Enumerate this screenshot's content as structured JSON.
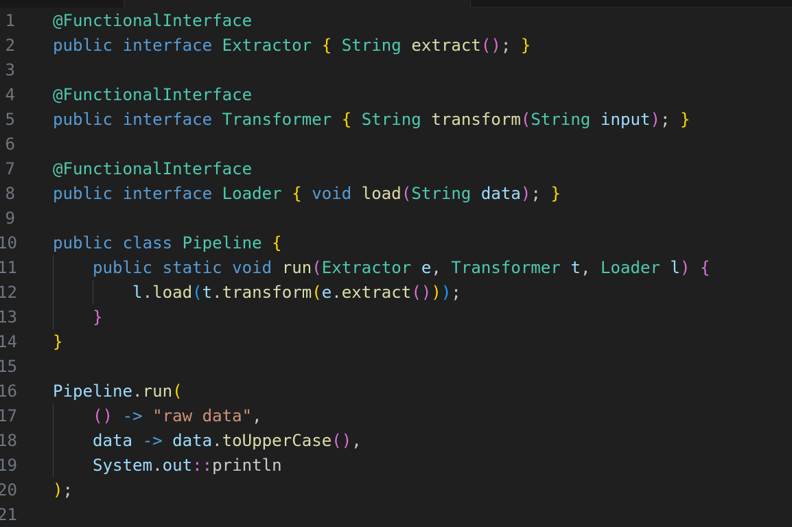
{
  "editor": {
    "language": "java",
    "lines": [
      {
        "number": "1",
        "tokens": [
          {
            "t": "@FunctionalInterface",
            "c": "ty"
          }
        ]
      },
      {
        "number": "2",
        "tokens": [
          {
            "t": "public",
            "c": "kw"
          },
          {
            "t": " ",
            "c": "pl"
          },
          {
            "t": "interface",
            "c": "kw"
          },
          {
            "t": " ",
            "c": "pl"
          },
          {
            "t": "Extractor",
            "c": "ty"
          },
          {
            "t": " ",
            "c": "pl"
          },
          {
            "t": "{",
            "c": "b1"
          },
          {
            "t": " ",
            "c": "pl"
          },
          {
            "t": "String",
            "c": "ty"
          },
          {
            "t": " ",
            "c": "pl"
          },
          {
            "t": "extract",
            "c": "fn"
          },
          {
            "t": "()",
            "c": "b2"
          },
          {
            "t": "; ",
            "c": "pl"
          },
          {
            "t": "}",
            "c": "b1"
          }
        ]
      },
      {
        "number": "3",
        "tokens": []
      },
      {
        "number": "4",
        "tokens": [
          {
            "t": "@FunctionalInterface",
            "c": "ty"
          }
        ]
      },
      {
        "number": "5",
        "tokens": [
          {
            "t": "public",
            "c": "kw"
          },
          {
            "t": " ",
            "c": "pl"
          },
          {
            "t": "interface",
            "c": "kw"
          },
          {
            "t": " ",
            "c": "pl"
          },
          {
            "t": "Transformer",
            "c": "ty"
          },
          {
            "t": " ",
            "c": "pl"
          },
          {
            "t": "{",
            "c": "b1"
          },
          {
            "t": " ",
            "c": "pl"
          },
          {
            "t": "String",
            "c": "ty"
          },
          {
            "t": " ",
            "c": "pl"
          },
          {
            "t": "transform",
            "c": "fn"
          },
          {
            "t": "(",
            "c": "b2"
          },
          {
            "t": "String",
            "c": "ty"
          },
          {
            "t": " ",
            "c": "pl"
          },
          {
            "t": "input",
            "c": "vr"
          },
          {
            "t": ")",
            "c": "b2"
          },
          {
            "t": "; ",
            "c": "pl"
          },
          {
            "t": "}",
            "c": "b1"
          }
        ]
      },
      {
        "number": "6",
        "tokens": []
      },
      {
        "number": "7",
        "tokens": [
          {
            "t": "@FunctionalInterface",
            "c": "ty"
          }
        ]
      },
      {
        "number": "8",
        "tokens": [
          {
            "t": "public",
            "c": "kw"
          },
          {
            "t": " ",
            "c": "pl"
          },
          {
            "t": "interface",
            "c": "kw"
          },
          {
            "t": " ",
            "c": "pl"
          },
          {
            "t": "Loader",
            "c": "ty"
          },
          {
            "t": " ",
            "c": "pl"
          },
          {
            "t": "{",
            "c": "b1"
          },
          {
            "t": " ",
            "c": "pl"
          },
          {
            "t": "void",
            "c": "kw"
          },
          {
            "t": " ",
            "c": "pl"
          },
          {
            "t": "load",
            "c": "fn"
          },
          {
            "t": "(",
            "c": "b2"
          },
          {
            "t": "String",
            "c": "ty"
          },
          {
            "t": " ",
            "c": "pl"
          },
          {
            "t": "data",
            "c": "vr"
          },
          {
            "t": ")",
            "c": "b2"
          },
          {
            "t": "; ",
            "c": "pl"
          },
          {
            "t": "}",
            "c": "b1"
          }
        ]
      },
      {
        "number": "9",
        "tokens": []
      },
      {
        "number": "10",
        "tokens": [
          {
            "t": "public",
            "c": "kw"
          },
          {
            "t": " ",
            "c": "pl"
          },
          {
            "t": "class",
            "c": "kw"
          },
          {
            "t": " ",
            "c": "pl"
          },
          {
            "t": "Pipeline",
            "c": "ty"
          },
          {
            "t": " ",
            "c": "pl"
          },
          {
            "t": "{",
            "c": "b1"
          }
        ]
      },
      {
        "number": "11",
        "tokens": [
          {
            "t": "    ",
            "c": "pl"
          },
          {
            "t": "public",
            "c": "kw"
          },
          {
            "t": " ",
            "c": "pl"
          },
          {
            "t": "static",
            "c": "kw"
          },
          {
            "t": " ",
            "c": "pl"
          },
          {
            "t": "void",
            "c": "kw"
          },
          {
            "t": " ",
            "c": "pl"
          },
          {
            "t": "run",
            "c": "fn"
          },
          {
            "t": "(",
            "c": "b2"
          },
          {
            "t": "Extractor",
            "c": "ty"
          },
          {
            "t": " ",
            "c": "pl"
          },
          {
            "t": "e",
            "c": "vr"
          },
          {
            "t": ", ",
            "c": "pl"
          },
          {
            "t": "Transformer",
            "c": "ty"
          },
          {
            "t": " ",
            "c": "pl"
          },
          {
            "t": "t",
            "c": "vr"
          },
          {
            "t": ", ",
            "c": "pl"
          },
          {
            "t": "Loader",
            "c": "ty"
          },
          {
            "t": " ",
            "c": "pl"
          },
          {
            "t": "l",
            "c": "vr"
          },
          {
            "t": ")",
            "c": "b2"
          },
          {
            "t": " ",
            "c": "pl"
          },
          {
            "t": "{",
            "c": "b2"
          }
        ]
      },
      {
        "number": "12",
        "tokens": [
          {
            "t": "        ",
            "c": "pl"
          },
          {
            "t": "l",
            "c": "vr"
          },
          {
            "t": ".",
            "c": "pl"
          },
          {
            "t": "load",
            "c": "fn"
          },
          {
            "t": "(",
            "c": "b3"
          },
          {
            "t": "t",
            "c": "vr"
          },
          {
            "t": ".",
            "c": "pl"
          },
          {
            "t": "transform",
            "c": "fn"
          },
          {
            "t": "(",
            "c": "b1"
          },
          {
            "t": "e",
            "c": "vr"
          },
          {
            "t": ".",
            "c": "pl"
          },
          {
            "t": "extract",
            "c": "fn"
          },
          {
            "t": "()",
            "c": "b2"
          },
          {
            "t": ")",
            "c": "b1"
          },
          {
            "t": ")",
            "c": "b3"
          },
          {
            "t": ";",
            "c": "pl"
          }
        ]
      },
      {
        "number": "13",
        "tokens": [
          {
            "t": "    ",
            "c": "pl"
          },
          {
            "t": "}",
            "c": "b2"
          }
        ]
      },
      {
        "number": "14",
        "tokens": [
          {
            "t": "}",
            "c": "b1"
          }
        ]
      },
      {
        "number": "15",
        "tokens": []
      },
      {
        "number": "16",
        "tokens": [
          {
            "t": "Pipeline",
            "c": "vr"
          },
          {
            "t": ".",
            "c": "pl"
          },
          {
            "t": "run",
            "c": "fn"
          },
          {
            "t": "(",
            "c": "b1"
          }
        ]
      },
      {
        "number": "17",
        "tokens": [
          {
            "t": "    ",
            "c": "pl"
          },
          {
            "t": "()",
            "c": "b2"
          },
          {
            "t": " ",
            "c": "pl"
          },
          {
            "t": "->",
            "c": "kw"
          },
          {
            "t": " ",
            "c": "pl"
          },
          {
            "t": "\"raw data\"",
            "c": "st"
          },
          {
            "t": ",",
            "c": "pl"
          }
        ]
      },
      {
        "number": "18",
        "tokens": [
          {
            "t": "    ",
            "c": "pl"
          },
          {
            "t": "data",
            "c": "vr"
          },
          {
            "t": " ",
            "c": "pl"
          },
          {
            "t": "->",
            "c": "kw"
          },
          {
            "t": " ",
            "c": "pl"
          },
          {
            "t": "data",
            "c": "vr"
          },
          {
            "t": ".",
            "c": "pl"
          },
          {
            "t": "toUpperCase",
            "c": "fn"
          },
          {
            "t": "()",
            "c": "b2"
          },
          {
            "t": ",",
            "c": "pl"
          }
        ]
      },
      {
        "number": "19",
        "tokens": [
          {
            "t": "    ",
            "c": "pl"
          },
          {
            "t": "System",
            "c": "vr"
          },
          {
            "t": ".",
            "c": "pl"
          },
          {
            "t": "out",
            "c": "vr"
          },
          {
            "t": "::",
            "c": "b2"
          },
          {
            "t": "println",
            "c": "pl"
          }
        ]
      },
      {
        "number": "20",
        "tokens": [
          {
            "t": ")",
            "c": "b1"
          },
          {
            "t": ";",
            "c": "pl"
          }
        ]
      },
      {
        "number": "21",
        "tokens": []
      }
    ]
  }
}
